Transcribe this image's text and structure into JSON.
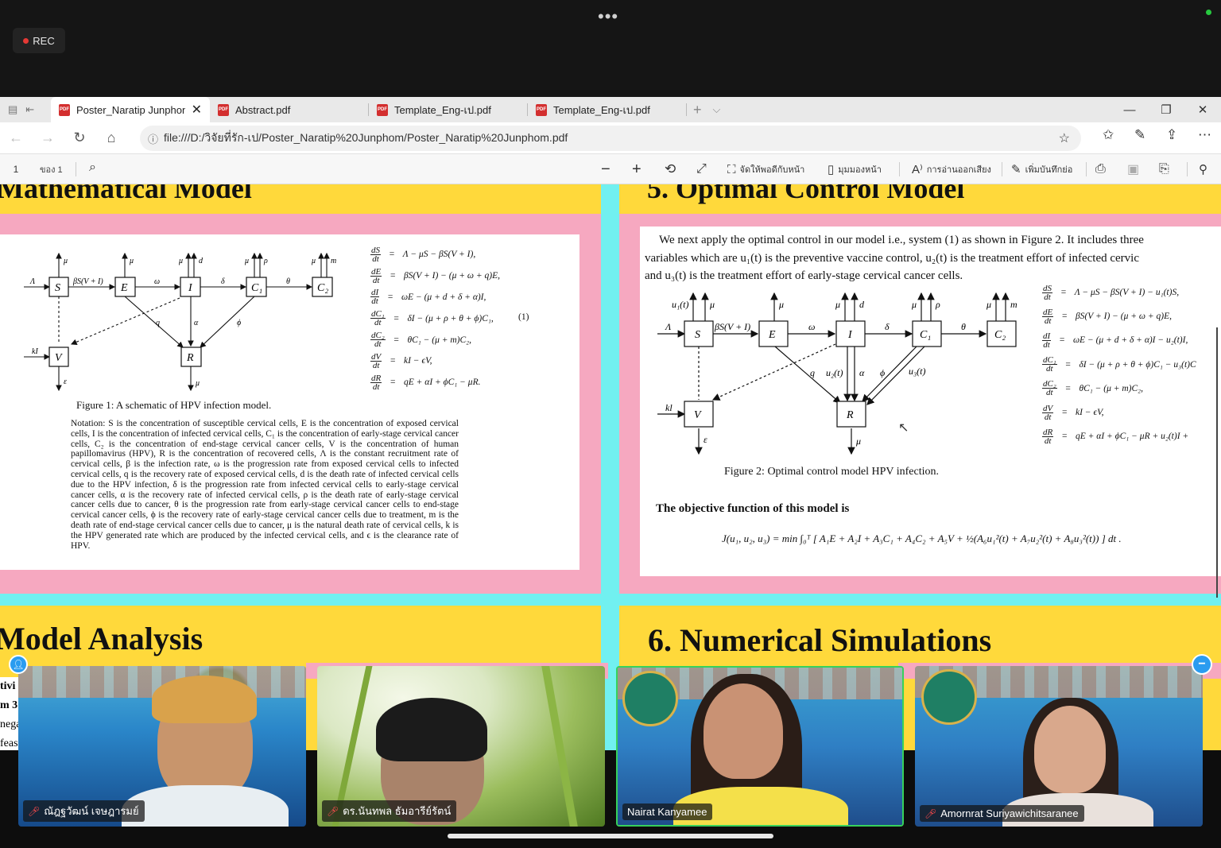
{
  "meeting": {
    "rec_label": "REC",
    "more_label": "•••"
  },
  "browser": {
    "tabs": [
      {
        "title": "Poster_Naratip Junphon",
        "active": true
      },
      {
        "title": "Abstract.pdf",
        "active": false
      },
      {
        "title": "Template_Eng-เป.pdf",
        "active": false
      },
      {
        "title": "Template_Eng-เป.pdf",
        "active": false
      }
    ],
    "url": "file:///D:/วิจัยที่รัก-เป/Poster_Naratip%20Junphom/Poster_Naratip%20Junphom.pdf"
  },
  "pdf_toolbar": {
    "page": "1",
    "of_pages": "ของ 1",
    "fit_page": "จัดให้พอดีกับหน้า",
    "page_view": "มุมมองหน้า",
    "read_aloud": "การอ่านออกเสียง",
    "add_note": "เพิ่มบันทึกย่อ"
  },
  "poster": {
    "left_heading_clip": "Mathematical Model",
    "right_heading_clip": "5. Optimal Control Model",
    "figure1_caption": "Figure 1: A schematic of HPV infection model.",
    "figure2_caption": "Figure 2: Optimal control model HPV infection.",
    "eq1_tag": "(1)",
    "notation": "Notation: S is the concentration of susceptible cervical cells, E is the concentration of exposed cervical cells, I is the concentration of infected cervical cells, C₁ is the concentration of early-stage cervical cancer cells, C₂ is the concentration of end-stage cervical cancer cells, V is the concentration of human papillomavirus (HPV), R is the concentration of recovered cells, Λ is the constant recruitment rate of cervical cells, β is the infection rate, ω is the progression rate from exposed cervical cells to infected cervical cells, q is the recovery rate of exposed cervical cells, d is the death rate of infected cervical cells due to the HPV infection, δ is the progression rate from infected cervical cells to early-stage cervical cancer cells, α is the recovery rate of infected cervical cells, ρ is the death rate of early-stage cervical cancer cells due to cancer, θ is the progression rate from early-stage cervical cancer cells to end-stage cervical cancer cells, ϕ is the recovery rate of early-stage cervical cancer cells due to treatment, m is the death rate of end-stage cervical cancer cells due to cancer, μ is the natural death rate of cervical cells, k is the HPV generated rate which are produced by the infected cervical cells, and ϵ is the clearance rate of HPV.",
    "intro_line1": "We next apply the optimal control in our model i.e., system (1) as shown in Figure 2. It includes three",
    "intro_line2": "variables which are  u₁(t)  is the preventive vaccine control,  u₂(t)  is the treatment effort of infected cervic",
    "intro_line3": "and u₃(t) is the treatment effort of early-stage cervical cancer cells.",
    "objective_heading": "The objective function of this model is",
    "objective": "J(u₁, u₂, u₃) = min ∫₀ᵀ [ A₁E + A₂I + A₃C₁ + A₄C₂ + A₅V + ½(A₆u₁²(t) + A₇u₂²(t) + A₈u₃²(t)) ] dt .",
    "left_bottom_heading": "Model Analysis",
    "right_bottom_heading": "6. Numerical Simulations",
    "system1": [
      {
        "lhs": "dS/dt",
        "rhs": "Λ − μS − βS(V + I),"
      },
      {
        "lhs": "dE/dt",
        "rhs": "βS(V + I) − (μ + ω + q)E,"
      },
      {
        "lhs": "dI/dt",
        "rhs": "ωE − (μ + d + δ + α)I,"
      },
      {
        "lhs": "dC₁/dt",
        "rhs": "δI − (μ + ρ + θ + ϕ)C₁,"
      },
      {
        "lhs": "dC₂/dt",
        "rhs": "θC₁ − (μ + m)C₂,"
      },
      {
        "lhs": "dV/dt",
        "rhs": "kI − ϵV,"
      },
      {
        "lhs": "dR/dt",
        "rhs": "qE + αI + ϕC₁ − μR."
      }
    ],
    "system2": [
      {
        "lhs": "dS/dt",
        "rhs": "Λ − μS − βS(V + I) − u₁(t)S,"
      },
      {
        "lhs": "dE/dt",
        "rhs": "βS(V + I) − (μ + ω + q)E,"
      },
      {
        "lhs": "dI/dt",
        "rhs": "ωE − (μ + d + δ + α)I − u₂(t)I,"
      },
      {
        "lhs": "dC₁/dt",
        "rhs": "δI − (μ + ρ + θ + ϕ)C₁ − u₃(t)C"
      },
      {
        "lhs": "dC₂/dt",
        "rhs": "θC₁ − (μ + m)C₂,"
      },
      {
        "lhs": "dV/dt",
        "rhs": "kI − ϵV,"
      },
      {
        "lhs": "dR/dt",
        "rhs": "qE + αI + ϕC₁ − μR + u₂(t)I +"
      }
    ],
    "left_partial_text": [
      "tivi",
      "m 3",
      "nega",
      "feas"
    ]
  },
  "participants": [
    {
      "name": "ณัฎฐวัฒน์ เจษฎารมย์",
      "muted": true
    },
    {
      "name": "ดร.นันทพล ธัมอารีย์รัตน์",
      "muted": true
    },
    {
      "name": "Nairat Kanyamee",
      "muted": false
    },
    {
      "name": "Amornrat Suriyawichitsaranee",
      "muted": true
    }
  ]
}
